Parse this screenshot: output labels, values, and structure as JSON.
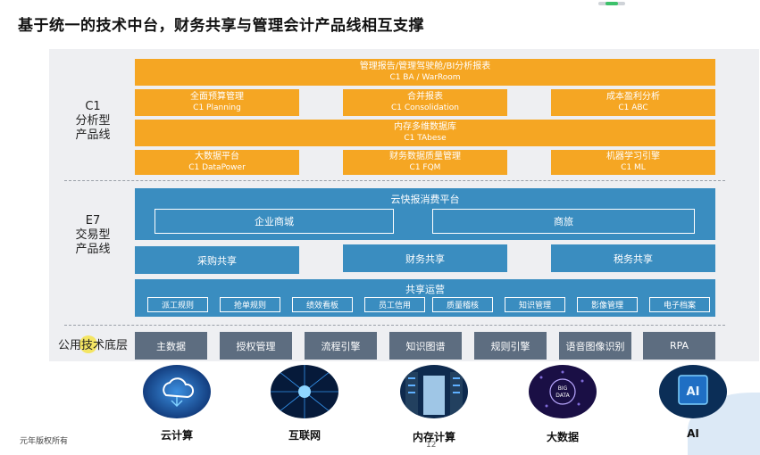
{
  "title": "基于统一的技术中台，财务共享与管理会计产品线相互支撑",
  "layers": {
    "c1": {
      "label": [
        "C1",
        "分析型",
        "产品线"
      ]
    },
    "e7": {
      "label": [
        "E7",
        "交易型",
        "产品线"
      ]
    },
    "base": {
      "label": "公用技术底层"
    }
  },
  "c1_blocks": [
    {
      "name": "管理报告/管理驾驶舱/BI分析报表",
      "sub": "C1 BA / WarRoom"
    },
    {
      "name": "全面预算管理",
      "sub": "C1 Planning"
    },
    {
      "name": "合并报表",
      "sub": "C1 Consolidation"
    },
    {
      "name": "成本盈利分析",
      "sub": "C1 ABC"
    },
    {
      "name": "内存多维数据库",
      "sub": "C1 TAbese"
    },
    {
      "name": "大数据平台",
      "sub": "C1 DataPower"
    },
    {
      "name": "财务数据质量管理",
      "sub": "C1 FQM"
    },
    {
      "name": "机器学习引擎",
      "sub": "C1 ML"
    }
  ],
  "e7_blocks": {
    "expense_platform": "云快报消费平台",
    "mall": "企业商城",
    "travel": "商旅",
    "procurement": "采购共享",
    "finance": "财务共享",
    "tax": "税务共享",
    "operations": "共享运营",
    "ops_items": [
      "派工规则",
      "抢单规则",
      "绩效看板",
      "员工信用",
      "质量稽核",
      "知识管理",
      "影像管理",
      "电子档案"
    ]
  },
  "base_items": [
    "主数据",
    "授权管理",
    "流程引擎",
    "知识图谱",
    "规则引擎",
    "语音图像识别",
    "RPA"
  ],
  "tech": [
    {
      "label": "云计算",
      "icon": "cloud-computing-icon"
    },
    {
      "label": "互联网",
      "icon": "internet-icon"
    },
    {
      "label": "内存计算",
      "icon": "in-memory-computing-icon"
    },
    {
      "label": "大数据",
      "icon": "big-data-icon",
      "inner": "BIG DATA"
    },
    {
      "label": "AI",
      "icon": "ai-icon",
      "inner": "AI"
    }
  ],
  "footer": "元年版权所有",
  "page_number": "12",
  "colors": {
    "orange": "#f5a623",
    "blue": "#3a8dc0",
    "slate": "#5d6d80",
    "panel": "#eeeff2"
  }
}
